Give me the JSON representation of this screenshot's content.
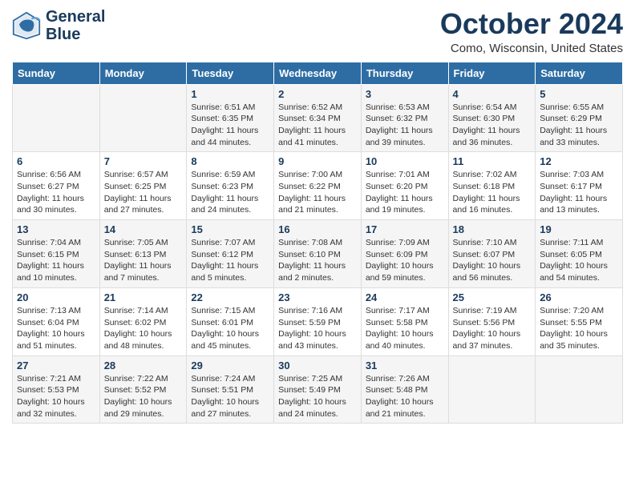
{
  "header": {
    "logo_line1": "General",
    "logo_line2": "Blue",
    "month_title": "October 2024",
    "location": "Como, Wisconsin, United States"
  },
  "weekdays": [
    "Sunday",
    "Monday",
    "Tuesday",
    "Wednesday",
    "Thursday",
    "Friday",
    "Saturday"
  ],
  "weeks": [
    [
      {
        "day": "",
        "info": ""
      },
      {
        "day": "",
        "info": ""
      },
      {
        "day": "1",
        "sunrise": "Sunrise: 6:51 AM",
        "sunset": "Sunset: 6:35 PM",
        "daylight": "Daylight: 11 hours and 44 minutes."
      },
      {
        "day": "2",
        "sunrise": "Sunrise: 6:52 AM",
        "sunset": "Sunset: 6:34 PM",
        "daylight": "Daylight: 11 hours and 41 minutes."
      },
      {
        "day": "3",
        "sunrise": "Sunrise: 6:53 AM",
        "sunset": "Sunset: 6:32 PM",
        "daylight": "Daylight: 11 hours and 39 minutes."
      },
      {
        "day": "4",
        "sunrise": "Sunrise: 6:54 AM",
        "sunset": "Sunset: 6:30 PM",
        "daylight": "Daylight: 11 hours and 36 minutes."
      },
      {
        "day": "5",
        "sunrise": "Sunrise: 6:55 AM",
        "sunset": "Sunset: 6:29 PM",
        "daylight": "Daylight: 11 hours and 33 minutes."
      }
    ],
    [
      {
        "day": "6",
        "sunrise": "Sunrise: 6:56 AM",
        "sunset": "Sunset: 6:27 PM",
        "daylight": "Daylight: 11 hours and 30 minutes."
      },
      {
        "day": "7",
        "sunrise": "Sunrise: 6:57 AM",
        "sunset": "Sunset: 6:25 PM",
        "daylight": "Daylight: 11 hours and 27 minutes."
      },
      {
        "day": "8",
        "sunrise": "Sunrise: 6:59 AM",
        "sunset": "Sunset: 6:23 PM",
        "daylight": "Daylight: 11 hours and 24 minutes."
      },
      {
        "day": "9",
        "sunrise": "Sunrise: 7:00 AM",
        "sunset": "Sunset: 6:22 PM",
        "daylight": "Daylight: 11 hours and 21 minutes."
      },
      {
        "day": "10",
        "sunrise": "Sunrise: 7:01 AM",
        "sunset": "Sunset: 6:20 PM",
        "daylight": "Daylight: 11 hours and 19 minutes."
      },
      {
        "day": "11",
        "sunrise": "Sunrise: 7:02 AM",
        "sunset": "Sunset: 6:18 PM",
        "daylight": "Daylight: 11 hours and 16 minutes."
      },
      {
        "day": "12",
        "sunrise": "Sunrise: 7:03 AM",
        "sunset": "Sunset: 6:17 PM",
        "daylight": "Daylight: 11 hours and 13 minutes."
      }
    ],
    [
      {
        "day": "13",
        "sunrise": "Sunrise: 7:04 AM",
        "sunset": "Sunset: 6:15 PM",
        "daylight": "Daylight: 11 hours and 10 minutes."
      },
      {
        "day": "14",
        "sunrise": "Sunrise: 7:05 AM",
        "sunset": "Sunset: 6:13 PM",
        "daylight": "Daylight: 11 hours and 7 minutes."
      },
      {
        "day": "15",
        "sunrise": "Sunrise: 7:07 AM",
        "sunset": "Sunset: 6:12 PM",
        "daylight": "Daylight: 11 hours and 5 minutes."
      },
      {
        "day": "16",
        "sunrise": "Sunrise: 7:08 AM",
        "sunset": "Sunset: 6:10 PM",
        "daylight": "Daylight: 11 hours and 2 minutes."
      },
      {
        "day": "17",
        "sunrise": "Sunrise: 7:09 AM",
        "sunset": "Sunset: 6:09 PM",
        "daylight": "Daylight: 10 hours and 59 minutes."
      },
      {
        "day": "18",
        "sunrise": "Sunrise: 7:10 AM",
        "sunset": "Sunset: 6:07 PM",
        "daylight": "Daylight: 10 hours and 56 minutes."
      },
      {
        "day": "19",
        "sunrise": "Sunrise: 7:11 AM",
        "sunset": "Sunset: 6:05 PM",
        "daylight": "Daylight: 10 hours and 54 minutes."
      }
    ],
    [
      {
        "day": "20",
        "sunrise": "Sunrise: 7:13 AM",
        "sunset": "Sunset: 6:04 PM",
        "daylight": "Daylight: 10 hours and 51 minutes."
      },
      {
        "day": "21",
        "sunrise": "Sunrise: 7:14 AM",
        "sunset": "Sunset: 6:02 PM",
        "daylight": "Daylight: 10 hours and 48 minutes."
      },
      {
        "day": "22",
        "sunrise": "Sunrise: 7:15 AM",
        "sunset": "Sunset: 6:01 PM",
        "daylight": "Daylight: 10 hours and 45 minutes."
      },
      {
        "day": "23",
        "sunrise": "Sunrise: 7:16 AM",
        "sunset": "Sunset: 5:59 PM",
        "daylight": "Daylight: 10 hours and 43 minutes."
      },
      {
        "day": "24",
        "sunrise": "Sunrise: 7:17 AM",
        "sunset": "Sunset: 5:58 PM",
        "daylight": "Daylight: 10 hours and 40 minutes."
      },
      {
        "day": "25",
        "sunrise": "Sunrise: 7:19 AM",
        "sunset": "Sunset: 5:56 PM",
        "daylight": "Daylight: 10 hours and 37 minutes."
      },
      {
        "day": "26",
        "sunrise": "Sunrise: 7:20 AM",
        "sunset": "Sunset: 5:55 PM",
        "daylight": "Daylight: 10 hours and 35 minutes."
      }
    ],
    [
      {
        "day": "27",
        "sunrise": "Sunrise: 7:21 AM",
        "sunset": "Sunset: 5:53 PM",
        "daylight": "Daylight: 10 hours and 32 minutes."
      },
      {
        "day": "28",
        "sunrise": "Sunrise: 7:22 AM",
        "sunset": "Sunset: 5:52 PM",
        "daylight": "Daylight: 10 hours and 29 minutes."
      },
      {
        "day": "29",
        "sunrise": "Sunrise: 7:24 AM",
        "sunset": "Sunset: 5:51 PM",
        "daylight": "Daylight: 10 hours and 27 minutes."
      },
      {
        "day": "30",
        "sunrise": "Sunrise: 7:25 AM",
        "sunset": "Sunset: 5:49 PM",
        "daylight": "Daylight: 10 hours and 24 minutes."
      },
      {
        "day": "31",
        "sunrise": "Sunrise: 7:26 AM",
        "sunset": "Sunset: 5:48 PM",
        "daylight": "Daylight: 10 hours and 21 minutes."
      },
      {
        "day": "",
        "info": ""
      },
      {
        "day": "",
        "info": ""
      }
    ]
  ]
}
